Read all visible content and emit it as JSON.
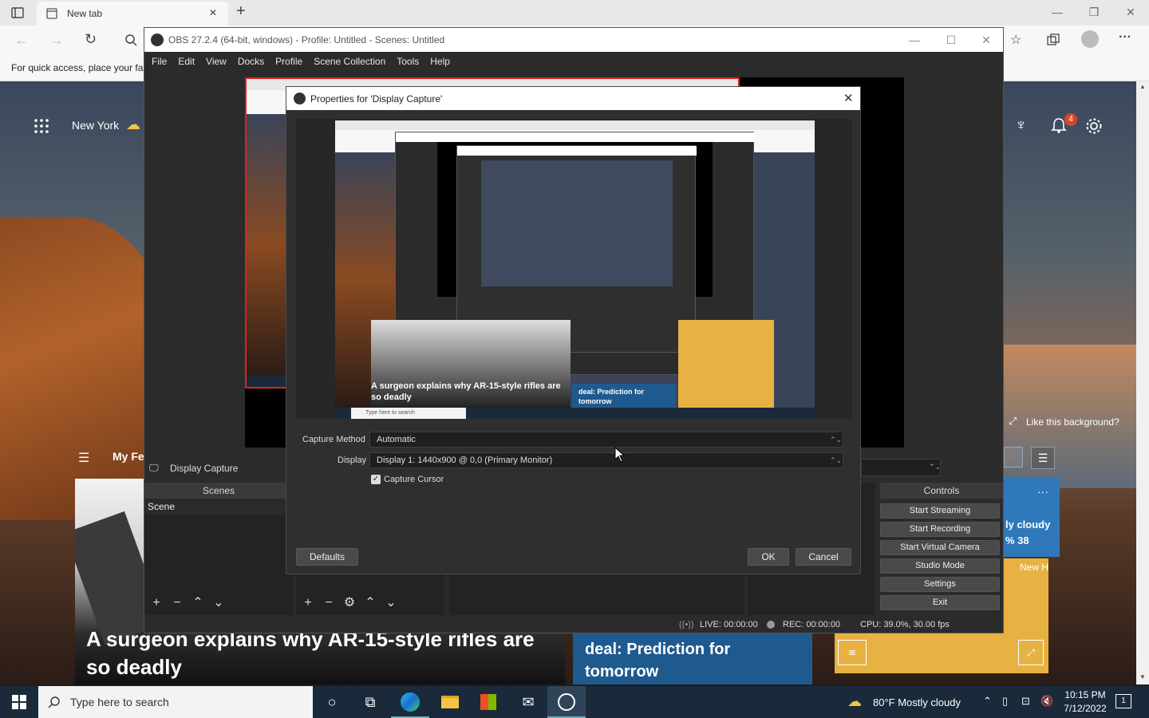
{
  "edge": {
    "tab_title": "New tab",
    "favorites_hint": "For quick access, place your fa",
    "tab_close": "✕",
    "new_tab": "+",
    "more": "···"
  },
  "ntp": {
    "location": "New York",
    "notification_count": "4",
    "like_background": "Like this background?",
    "my_feed": "My Fe",
    "headline_main": "A surgeon explains why AR-15-style rifles are so deadly",
    "headline_deal": "deal: Prediction for tomorrow",
    "weather_tile_text": "ly cloudy",
    "weather_tile_temp": "% 38",
    "weather_tile_new": "New H"
  },
  "obs": {
    "title": "OBS 27.2.4 (64-bit, windows) - Profile: Untitled - Scenes: Untitled",
    "menu": [
      "File",
      "Edit",
      "View",
      "Docks",
      "Profile",
      "Scene Collection",
      "Tools",
      "Help"
    ],
    "source_label": "Display Capture",
    "scenes_header": "Scenes",
    "scene_item": "Scene",
    "controls_header": "Controls",
    "controls": [
      "Start Streaming",
      "Start Recording",
      "Start Virtual Camera",
      "Studio Mode",
      "Settings",
      "Exit"
    ],
    "status": {
      "live": "LIVE: 00:00:00",
      "rec": "REC: 00:00:00",
      "cpu": "CPU: 39.0%, 30.00 fps"
    }
  },
  "dialog": {
    "title": "Properties for 'Display Capture'",
    "capture_method_label": "Capture Method",
    "capture_method_value": "Automatic",
    "display_label": "Display",
    "display_value": "Display 1: 1440x900 @ 0,0 (Primary Monitor)",
    "capture_cursor_label": "Capture Cursor",
    "capture_cursor_checked": true,
    "defaults_button": "Defaults",
    "ok_button": "OK",
    "cancel_button": "Cancel"
  },
  "nested_preview": {
    "headline": "A surgeon explains why AR-15-style rifles are so deadly",
    "deal": "deal: Prediction for tomorrow",
    "search": "Type here to search"
  },
  "taskbar": {
    "search_placeholder": "Type here to search",
    "weather": "80°F  Mostly cloudy",
    "time": "10:15 PM",
    "date": "7/12/2022",
    "notif_count": "1"
  }
}
